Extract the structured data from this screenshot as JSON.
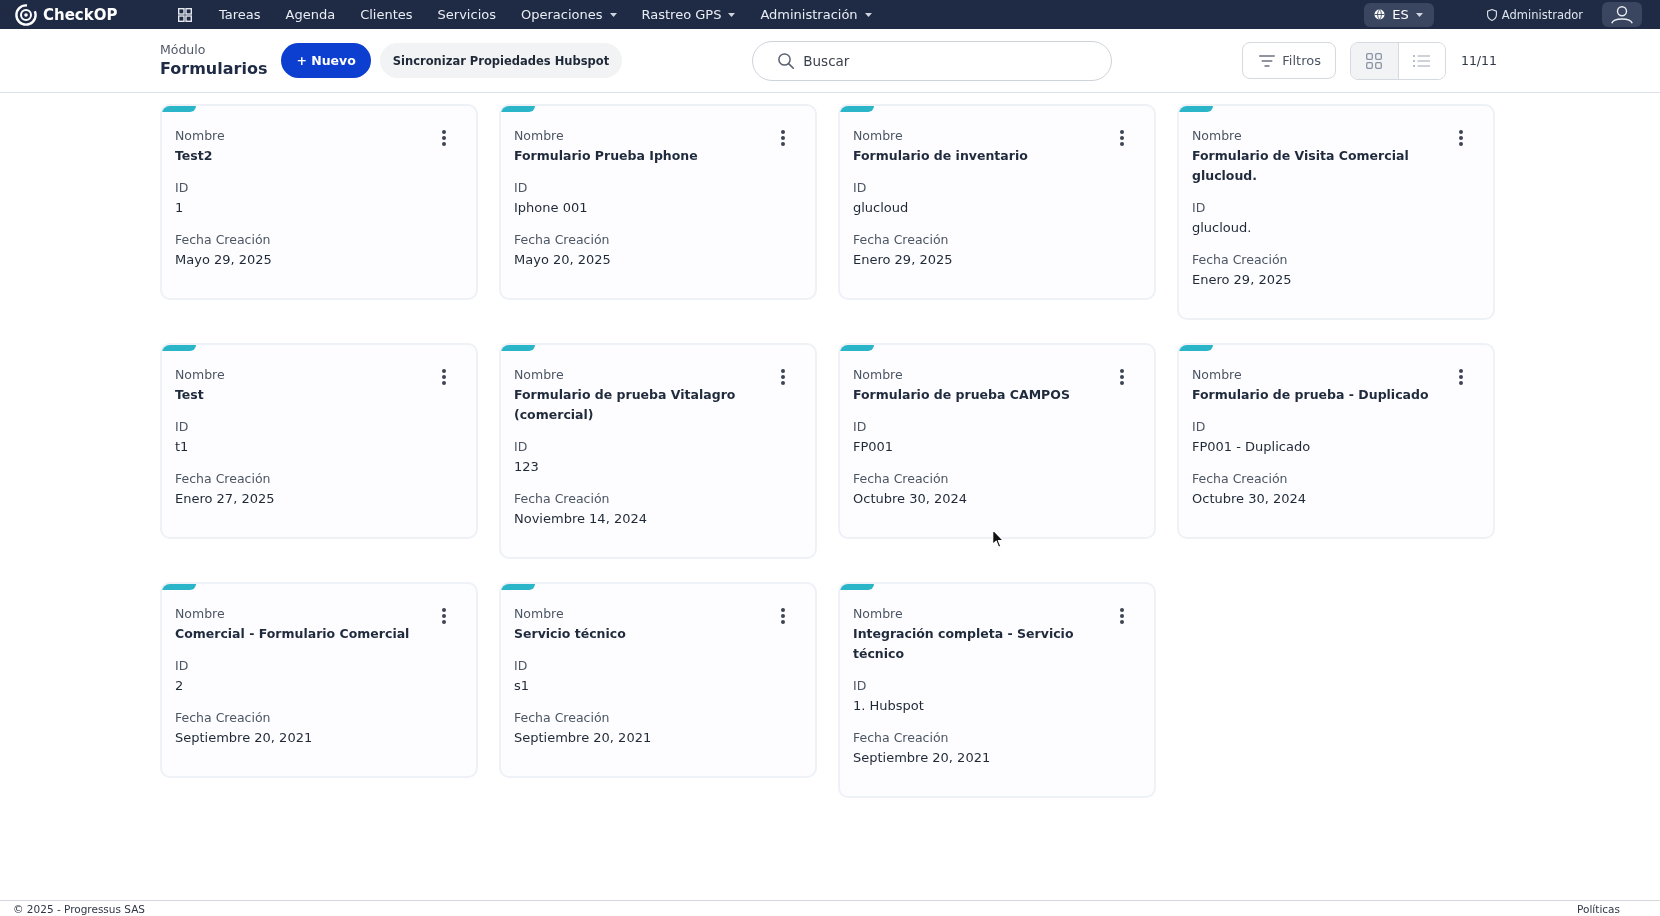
{
  "navbar": {
    "logo": "CheckOP",
    "items": [
      {
        "label": "Tareas",
        "has_menu": false
      },
      {
        "label": "Agenda",
        "has_menu": false
      },
      {
        "label": "Clientes",
        "has_menu": false
      },
      {
        "label": "Servicios",
        "has_menu": false
      },
      {
        "label": "Operaciones",
        "has_menu": true
      },
      {
        "label": "Rastreo GPS",
        "has_menu": true
      },
      {
        "label": "Administración",
        "has_menu": true
      }
    ],
    "language": "ES",
    "role": "Administrador"
  },
  "header": {
    "module_label": "Módulo",
    "module_title": "Formularios",
    "new_button": "+ Nuevo",
    "sync_button": "Sincronizar Propiedades Hubspot",
    "search": {
      "placeholder": "Buscar"
    },
    "filters_button": "Filtros",
    "views": [
      {
        "kind": "grid",
        "selected": true
      },
      {
        "kind": "list",
        "selected": false
      }
    ],
    "count": "11/11"
  },
  "cards": [
    {
      "name_label": "Nombre",
      "name": "Test2",
      "id_label": "ID",
      "id": "1",
      "date_label": "Fecha Creación",
      "date": "Mayo 29, 2025"
    },
    {
      "name_label": "Nombre",
      "name": "Formulario Prueba Iphone",
      "id_label": "ID",
      "id": "Iphone 001",
      "date_label": "Fecha Creación",
      "date": "Mayo 20, 2025"
    },
    {
      "name_label": "Nombre",
      "name": "Formulario de inventario",
      "id_label": "ID",
      "id": "glucloud",
      "date_label": "Fecha Creación",
      "date": "Enero 29, 2025"
    },
    {
      "name_label": "Nombre",
      "name": "Formulario de Visita Comercial glucloud.",
      "id_label": "ID",
      "id": "glucloud.",
      "date_label": "Fecha Creación",
      "date": "Enero 29, 2025"
    },
    {
      "name_label": "Nombre",
      "name": "Test",
      "id_label": "ID",
      "id": "t1",
      "date_label": "Fecha Creación",
      "date": "Enero 27, 2025"
    },
    {
      "name_label": "Nombre",
      "name": "Formulario de prueba Vitalagro (comercial)",
      "id_label": "ID",
      "id": "123",
      "date_label": "Fecha Creación",
      "date": "Noviembre 14, 2024"
    },
    {
      "name_label": "Nombre",
      "name": "Formulario de prueba CAMPOS",
      "id_label": "ID",
      "id": "FP001",
      "date_label": "Fecha Creación",
      "date": "Octubre 30, 2024"
    },
    {
      "name_label": "Nombre",
      "name": "Formulario de prueba - Duplicado",
      "id_label": "ID",
      "id": "FP001 - Duplicado",
      "date_label": "Fecha Creación",
      "date": "Octubre 30, 2024"
    },
    {
      "name_label": "Nombre",
      "name": "Comercial - Formulario Comercial",
      "id_label": "ID",
      "id": "2",
      "date_label": "Fecha Creación",
      "date": "Septiembre 20, 2021"
    },
    {
      "name_label": "Nombre",
      "name": "Servicio técnico",
      "id_label": "ID",
      "id": "s1",
      "date_label": "Fecha Creación",
      "date": "Septiembre 20, 2021"
    },
    {
      "name_label": "Nombre",
      "name": "Integración completa - Servicio técnico",
      "id_label": "ID",
      "id": "1. Hubspot",
      "date_label": "Fecha Creación",
      "date": "Septiembre 20, 2021"
    }
  ],
  "footer": {
    "copyright": "© 2025 - Progressus SAS",
    "policies_link": "Políticas"
  }
}
